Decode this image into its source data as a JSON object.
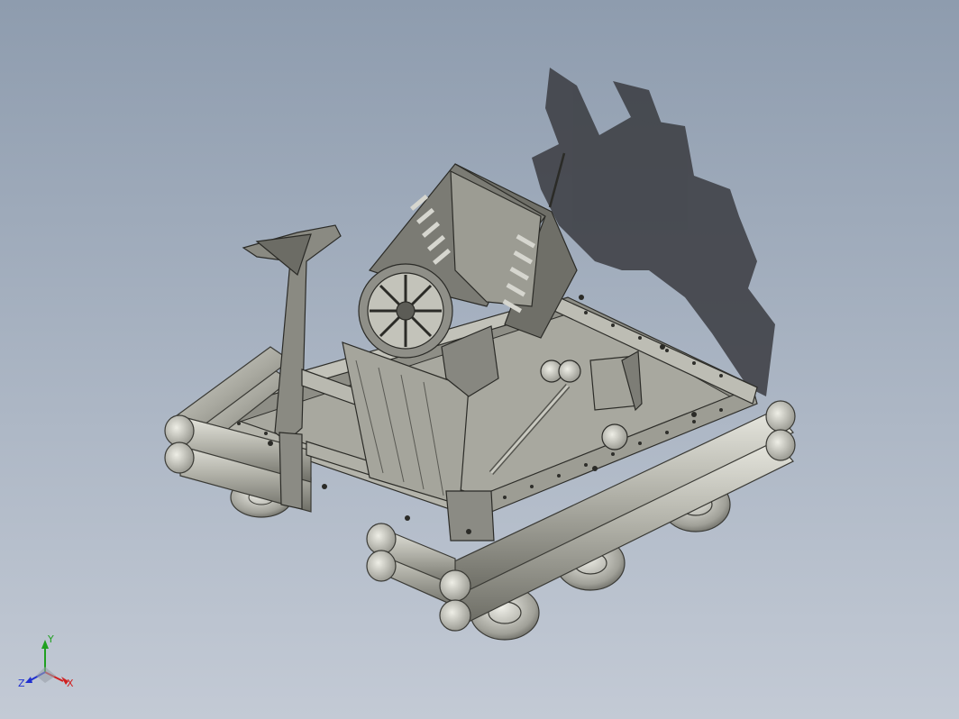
{
  "viewport": {
    "background_top": "#8e9cae",
    "background_bottom": "#c3cad5",
    "model_color": "#9a9a90",
    "shadow_color": "#3d3f44"
  },
  "triad": {
    "x_label": "X",
    "y_label": "Y",
    "z_label": "Z",
    "x_color": "#d02020",
    "y_color": "#20a020",
    "z_color": "#2030d0"
  }
}
